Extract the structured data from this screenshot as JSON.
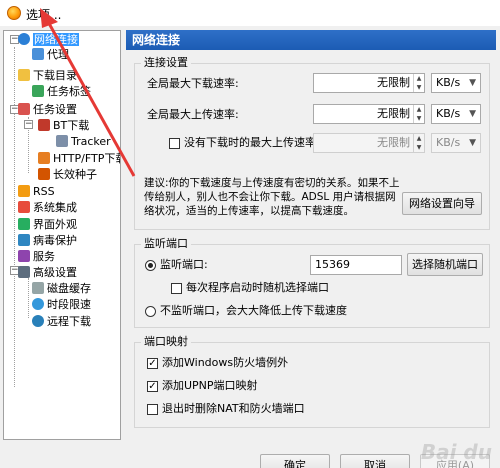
{
  "window": {
    "title": "选项..."
  },
  "tree": {
    "items": [
      {
        "label": "网络连接",
        "icon": "globe-icon"
      },
      {
        "label": "代理",
        "icon": "network-icon"
      },
      {
        "label": "下载目录",
        "icon": "folder-icon"
      },
      {
        "label": "任务标签",
        "icon": "tag-icon"
      },
      {
        "label": "任务设置",
        "icon": "task-icon"
      },
      {
        "label": "BT下载",
        "icon": "bt-icon"
      },
      {
        "label": "Tracker",
        "icon": "tracker-icon"
      },
      {
        "label": "HTTP/FTP下载",
        "icon": "http-icon"
      },
      {
        "label": "长效种子",
        "icon": "seed-icon"
      },
      {
        "label": "RSS",
        "icon": "rss-icon"
      },
      {
        "label": "系统集成",
        "icon": "integration-icon"
      },
      {
        "label": "界面外观",
        "icon": "appearance-icon"
      },
      {
        "label": "病毒保护",
        "icon": "shield-icon"
      },
      {
        "label": "服务",
        "icon": "service-icon"
      },
      {
        "label": "高级设置",
        "icon": "advanced-icon"
      },
      {
        "label": "磁盘缓存",
        "icon": "disk-icon"
      },
      {
        "label": "时段限速",
        "icon": "clock-icon"
      },
      {
        "label": "远程下载",
        "icon": "remote-icon"
      }
    ]
  },
  "panel": {
    "header": "网络连接",
    "connection": {
      "title": "连接设置",
      "max_download_label": "全局最大下载速率:",
      "max_download_value": "无限制",
      "max_download_unit": "KB/s",
      "max_upload_label": "全局最大上传速率:",
      "max_upload_value": "无限制",
      "max_upload_unit": "KB/s",
      "idle_upload_label": "没有下载时的最大上传速率",
      "idle_upload_value": "无限制",
      "idle_upload_unit": "KB/s",
      "hint": "建议:你的下载速度与上传速度有密切的关系。如果不上传给别人，别人也不会让你下载。ADSL 用户请根据网络状况，适当的上传速率，以提高下载速度。",
      "wizard_button": "网络设置向导"
    },
    "listen": {
      "title": "监听端口",
      "listen_label": "监听端口:",
      "port_value": "15369",
      "random_button": "选择随机端口",
      "random_on_start_label": "每次程序启动时随机选择端口",
      "no_listen_label": "不监听端口，会大大降低上传下载速度"
    },
    "mapping": {
      "title": "端口映射",
      "firewall_label": "添加Windows防火墙例外",
      "upnp_label": "添加UPNP端口映射",
      "remove_on_exit_label": "退出时删除NAT和防火墙端口"
    }
  },
  "footer": {
    "ok": "确定",
    "cancel": "取消",
    "apply": "应用(A)"
  },
  "colors": {
    "accent": "#1c5cb4",
    "selection": "#3399ff",
    "arrow": "#e53935"
  }
}
